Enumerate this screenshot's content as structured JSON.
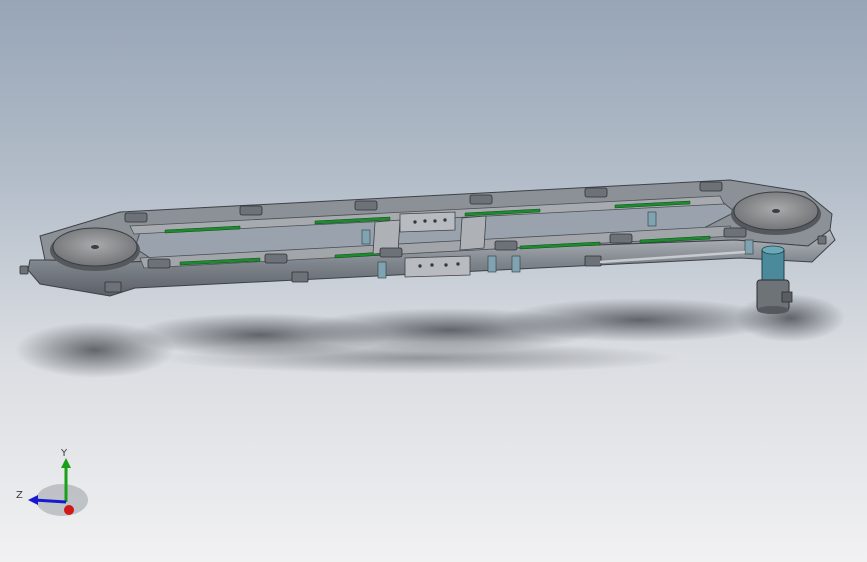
{
  "viewport": {
    "background_top": "#97a5b7",
    "background_bottom": "#f1f1f2",
    "model_color": "#8f949a",
    "accent_green": "#1e8a2f",
    "motor_color": "#4a8a9a"
  },
  "triad": {
    "x_color": "#d01818",
    "y_color": "#18a018",
    "z_color": "#1818d0",
    "y_label": "Y",
    "z_label": "Z"
  }
}
